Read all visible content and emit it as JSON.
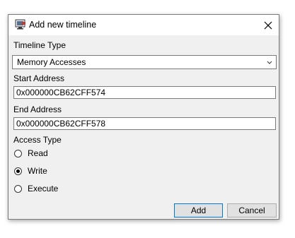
{
  "dialog": {
    "title": "Add new timeline",
    "close_icon": "close-icon",
    "app_icon": "app-icon"
  },
  "timeline_type": {
    "label": "Timeline Type",
    "selected": "Memory Accesses"
  },
  "start_address": {
    "label": "Start Address",
    "value": "0x000000CB62CFF574"
  },
  "end_address": {
    "label": "End Address",
    "value": "0x000000CB62CFF578"
  },
  "access_type": {
    "label": "Access Type",
    "options": [
      "Read",
      "Write",
      "Execute"
    ],
    "selected": "Write"
  },
  "buttons": {
    "add": "Add",
    "cancel": "Cancel"
  },
  "colors": {
    "dialog_bg": "#f0f0f0",
    "titlebar_bg": "#ffffff",
    "default_button_border": "#0078d7"
  }
}
